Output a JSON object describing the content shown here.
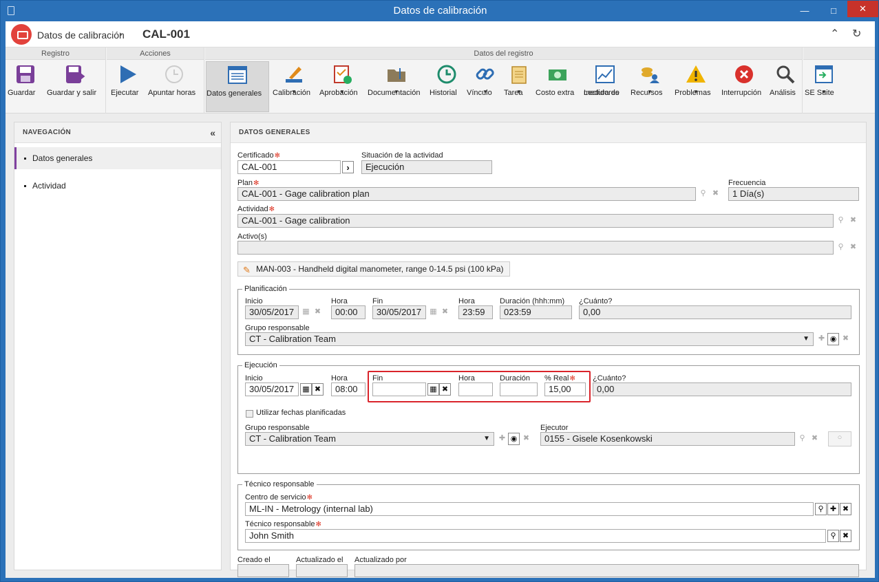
{
  "window": {
    "title": "Datos de calibración"
  },
  "header": {
    "module": "Datos de calibración",
    "record": "CAL-001"
  },
  "ribbon": {
    "groups": {
      "registro": "Registro",
      "acciones": "Acciones",
      "datos": "Datos del registro"
    },
    "buttons": {
      "guardar": "Guardar",
      "guardar_salir": "Guardar y salir",
      "ejecutar": "Ejecutar",
      "apuntar": "Apuntar horas",
      "datos_generales": "Datos generales",
      "calibracion": "Calibración",
      "aprobacion": "Aprobación",
      "documentacion": "Documentación",
      "historial": "Historial",
      "vinculo": "Vínculo",
      "tarea": "Tarea",
      "costo": "Costo extra",
      "lectura1": "Lectura de",
      "lectura2": "medidores",
      "recursos": "Recursos",
      "problemas": "Problemas",
      "interrupcion": "Interrupción",
      "analisis": "Análisis",
      "se_suite": "SE Suite"
    }
  },
  "nav": {
    "title": "NAVEGACIÓN",
    "items": [
      "Datos generales",
      "Actividad"
    ]
  },
  "main": {
    "title": "DATOS GENERALES",
    "certificado": {
      "label": "Certificado",
      "value": "CAL-001"
    },
    "situacion": {
      "label": "Situación de la actividad",
      "value": "Ejecución"
    },
    "plan": {
      "label": "Plan",
      "value": "CAL-001 - Gage calibration plan"
    },
    "frecuencia": {
      "label": "Frecuencia",
      "value": "1 Día(s)"
    },
    "actividad": {
      "label": "Actividad",
      "value": "CAL-001 - Gage calibration"
    },
    "activos": {
      "label": "Activo(s)",
      "value": ""
    },
    "asset_chip": "MAN-003 - Handheld digital manometer, range 0-14.5 psi (100 kPa)",
    "planificacion": {
      "legend": "Planificación",
      "inicio_label": "Inicio",
      "inicio": "30/05/2017",
      "hora_label": "Hora",
      "hora": "00:00",
      "fin_label": "Fin",
      "fin": "30/05/2017",
      "hora2_label": "Hora",
      "hora2": "23:59",
      "duracion_label": "Duración (hhh:mm)",
      "duracion": "023:59",
      "cuanto_label": "¿Cuánto?",
      "cuanto": "0,00",
      "grupo_label": "Grupo responsable",
      "grupo": "CT - Calibration Team"
    },
    "ejecucion": {
      "legend": "Ejecución",
      "inicio_label": "Inicio",
      "inicio": "30/05/2017",
      "hora_label": "Hora",
      "hora": "08:00",
      "fin_label": "Fin",
      "fin": "",
      "hora2_label": "Hora",
      "hora2": "",
      "duracion_label": "Duración",
      "duracion": "",
      "real_label": "% Real",
      "real": "15,00",
      "cuanto_label": "¿Cuánto?",
      "cuanto": "0,00",
      "utilizar": "Utilizar fechas planificadas",
      "grupo_label": "Grupo responsable",
      "grupo": "CT - Calibration Team",
      "ejecutor_label": "Ejecutor",
      "ejecutor": "0155 - Gisele Kosenkowski"
    },
    "tecnico": {
      "legend": "Técnico responsable",
      "centro_label": "Centro de servicio",
      "centro": "ML-IN - Metrology (internal lab)",
      "tecnico_label": "Técnico responsable",
      "tecnico": "John Smith"
    },
    "footer": {
      "creado": "Creado el",
      "actualizado": "Actualizado el",
      "actualizado_por": "Actualizado por"
    }
  },
  "colors": {
    "accent": "#7f3f9f",
    "highlight": "#d9232a",
    "window": "#2b71b8"
  }
}
